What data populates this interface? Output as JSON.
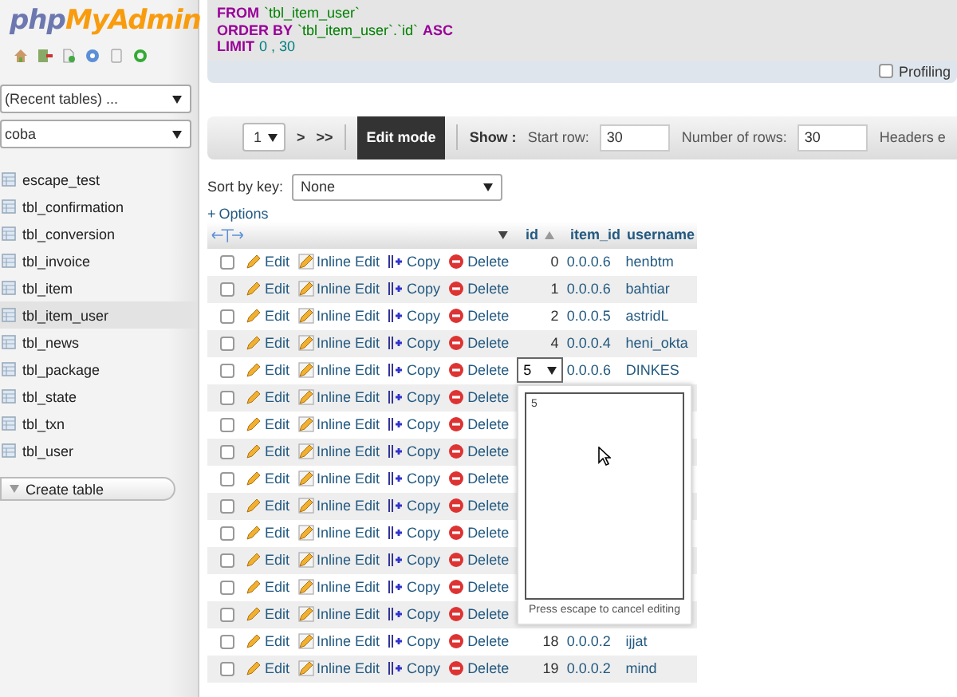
{
  "sidebar": {
    "logo": {
      "php": "php",
      "myadmin": "MyAdmin"
    },
    "recent_tables": "(Recent tables) ...",
    "database": "coba",
    "tables": [
      {
        "label": "escape_test",
        "selected": false
      },
      {
        "label": "tbl_confirmation",
        "selected": false
      },
      {
        "label": "tbl_conversion",
        "selected": false
      },
      {
        "label": "tbl_invoice",
        "selected": false
      },
      {
        "label": "tbl_item",
        "selected": false
      },
      {
        "label": "tbl_item_user",
        "selected": true
      },
      {
        "label": "tbl_news",
        "selected": false
      },
      {
        "label": "tbl_package",
        "selected": false
      },
      {
        "label": "tbl_state",
        "selected": false
      },
      {
        "label": "tbl_txn",
        "selected": false
      },
      {
        "label": "tbl_user",
        "selected": false
      }
    ],
    "create_table": "Create table"
  },
  "query": {
    "lines": [
      [
        {
          "kind": "keyword",
          "text": "FROM"
        },
        {
          "kind": "identifier",
          "text": "`tbl_item_user`"
        }
      ],
      [
        {
          "kind": "keyword",
          "text": "ORDER BY"
        },
        {
          "kind": "identifier",
          "text": "`tbl_item_user`.`id`"
        },
        {
          "kind": "keyword",
          "text": "ASC"
        }
      ],
      [
        {
          "kind": "keyword",
          "text": "LIMIT"
        },
        {
          "kind": "number",
          "text": "0 , 30"
        }
      ]
    ]
  },
  "profiling": {
    "label": "Profiling",
    "checked": false
  },
  "navigation": {
    "page": "1",
    "next": ">",
    "last": ">>",
    "edit_mode": "Edit mode",
    "show": "Show :",
    "start_row_label": "Start row:",
    "start_row": "30",
    "rows_label": "Number of rows:",
    "rows": "30",
    "headers_label": "Headers e"
  },
  "sort_by_key": {
    "label": "Sort by key:",
    "value": "None"
  },
  "options": {
    "sign": "+",
    "label": "Options"
  },
  "table": {
    "columns": [
      {
        "label": "id",
        "sorted": true
      },
      {
        "label": "item_id",
        "sorted": false
      },
      {
        "label": "username",
        "sorted": false
      }
    ],
    "rows": [
      {
        "checked": false,
        "edit": "Edit",
        "inline_edit": "Inline Edit",
        "copy": "Copy",
        "delete": "Delete",
        "editing": false,
        "id": "0",
        "item_id": "0.0.0.6",
        "username": "henbtm"
      },
      {
        "checked": false,
        "edit": "Edit",
        "inline_edit": "Inline Edit",
        "copy": "Copy",
        "delete": "Delete",
        "editing": false,
        "id": "1",
        "item_id": "0.0.0.6",
        "username": "bahtiar"
      },
      {
        "checked": false,
        "edit": "Edit",
        "inline_edit": "Inline Edit",
        "copy": "Copy",
        "delete": "Delete",
        "editing": false,
        "id": "2",
        "item_id": "0.0.0.5",
        "username": "astridL"
      },
      {
        "checked": false,
        "edit": "Edit",
        "inline_edit": "Inline Edit",
        "copy": "Copy",
        "delete": "Delete",
        "editing": false,
        "id": "4",
        "item_id": "0.0.0.4",
        "username": "heni_okta"
      },
      {
        "checked": false,
        "edit": "Edit",
        "inline_edit": "Inline Edit",
        "copy": "Copy",
        "delete": "Delete",
        "editing": true,
        "id": "5",
        "item_id": "0.0.0.6",
        "username": "DINKES"
      },
      {
        "checked": false,
        "edit": "Edit",
        "inline_edit": "Inline Edit",
        "copy": "Copy",
        "delete": "Delete",
        "editing": false
      },
      {
        "checked": false,
        "edit": "Edit",
        "inline_edit": "Inline Edit",
        "copy": "Copy",
        "delete": "Delete",
        "editing": false
      },
      {
        "checked": false,
        "edit": "Edit",
        "inline_edit": "Inline Edit",
        "copy": "Copy",
        "delete": "Delete",
        "editing": false
      },
      {
        "checked": false,
        "edit": "Edit",
        "inline_edit": "Inline Edit",
        "copy": "Copy",
        "delete": "Delete",
        "editing": false
      },
      {
        "checked": false,
        "edit": "Edit",
        "inline_edit": "Inline Edit",
        "copy": "Copy",
        "delete": "Delete",
        "editing": false
      },
      {
        "checked": false,
        "edit": "Edit",
        "inline_edit": "Inline Edit",
        "copy": "Copy",
        "delete": "Delete",
        "editing": false
      },
      {
        "checked": false,
        "edit": "Edit",
        "inline_edit": "Inline Edit",
        "copy": "Copy",
        "delete": "Delete",
        "editing": false
      },
      {
        "checked": false,
        "edit": "Edit",
        "inline_edit": "Inline Edit",
        "copy": "Copy",
        "delete": "Delete",
        "editing": false
      },
      {
        "checked": false,
        "edit": "Edit",
        "inline_edit": "Inline Edit",
        "copy": "Copy",
        "delete": "Delete",
        "editing": false
      },
      {
        "checked": false,
        "edit": "Edit",
        "inline_edit": "Inline Edit",
        "copy": "Copy",
        "delete": "Delete",
        "editing": false,
        "id": "18",
        "item_id": "0.0.0.2",
        "username": "ijjat"
      },
      {
        "checked": false,
        "edit": "Edit",
        "inline_edit": "Inline Edit",
        "copy": "Copy",
        "delete": "Delete",
        "editing": false,
        "id": "19",
        "item_id": "0.0.0.2",
        "username": "mind"
      }
    ]
  },
  "inline_editor": {
    "value": "5",
    "hint": "Press escape to cancel editing"
  }
}
